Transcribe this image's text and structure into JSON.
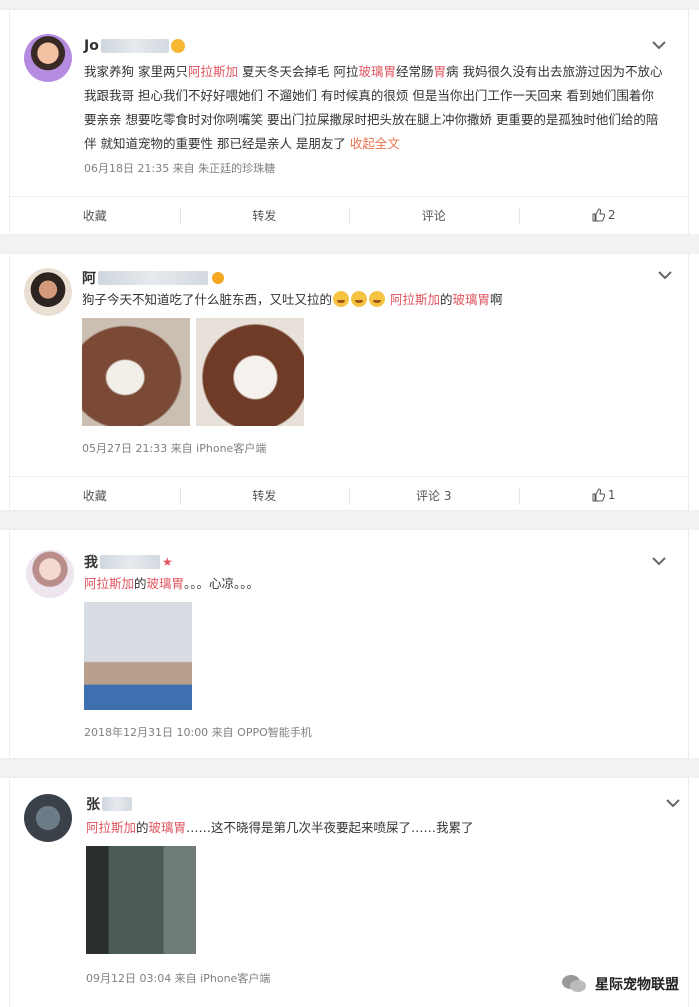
{
  "posts": [
    {
      "name": "Jo",
      "text": [
        {
          "t": "我家养狗 家里两只",
          "c": ""
        },
        {
          "t": "阿拉斯加",
          "c": "red"
        },
        {
          "t": " 夏天冬天会掉毛 阿拉",
          "c": ""
        },
        {
          "t": "玻璃胃",
          "c": "red"
        },
        {
          "t": "经常肠",
          "c": ""
        },
        {
          "t": "胃",
          "c": "red"
        },
        {
          "t": "病 我妈很久没有出去旅游过因为不放心我跟我哥 担心我们不好好喂她们 不遛她们 有时候真的很烦 但是当你出门工作一天回来 看到她们围着你要亲亲 想要吃零食时对你咧嘴笑 要出门拉屎撒尿时把头放在腿上冲你撒娇 更重要的是孤独时他们给的陪伴 就知道宠物的重要性 那已经是亲人 是朋友了 ",
          "c": ""
        },
        {
          "t": "收起全文",
          "c": "link"
        }
      ],
      "meta": "06月18日 21:35  来自 朱正廷的珍珠糖",
      "actions": {
        "fav": "收藏",
        "repost": "转发",
        "comment": "评论",
        "like": "2"
      }
    },
    {
      "name": "阿",
      "text": [
        {
          "t": "狗子今天不知道吃了什么脏东西，又吐又拉的",
          "c": ""
        },
        {
          "t": "EMOJI3",
          "c": "emoji"
        },
        {
          "t": " 阿拉斯加",
          "c": "red"
        },
        {
          "t": "的",
          "c": ""
        },
        {
          "t": "玻璃胃",
          "c": "red"
        },
        {
          "t": "啊",
          "c": ""
        }
      ],
      "meta": "05月27日 21:33  来自 iPhone客户端",
      "actions": {
        "fav": "收藏",
        "repost": "转发",
        "comment": "评论 3",
        "like": "1"
      }
    },
    {
      "name": "我",
      "text": [
        {
          "t": "阿拉斯加",
          "c": "red"
        },
        {
          "t": "的",
          "c": ""
        },
        {
          "t": "玻璃胃",
          "c": "red"
        },
        {
          "t": "。。。心凉。。。",
          "c": ""
        }
      ],
      "meta": "2018年12月31日 10:00  来自 OPPO智能手机"
    },
    {
      "name": "张",
      "text": [
        {
          "t": "阿拉斯加",
          "c": "red"
        },
        {
          "t": "的",
          "c": ""
        },
        {
          "t": "玻璃胃",
          "c": "red"
        },
        {
          "t": "……这不晓得是第几次半夜要起来喷屎了……我累了",
          "c": ""
        }
      ],
      "meta": "09月12日 03:04  来自 iPhone客户端"
    }
  ],
  "watermark": "星际宠物联盟"
}
